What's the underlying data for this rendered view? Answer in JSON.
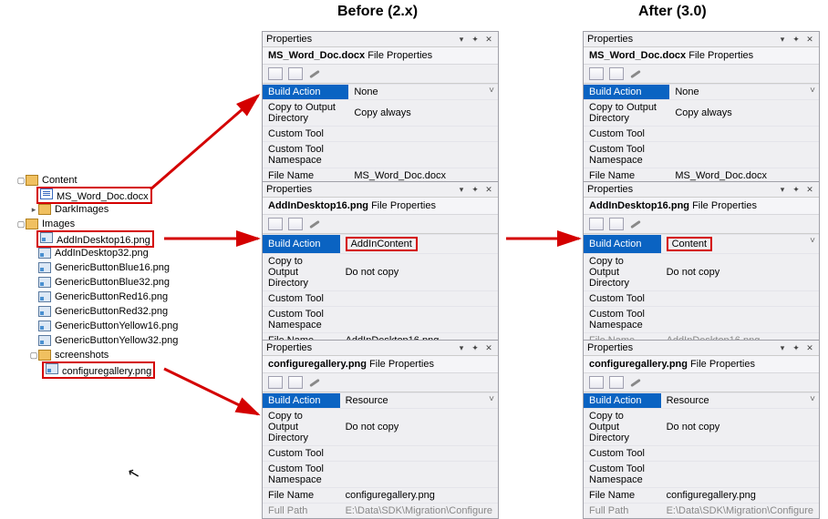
{
  "headers": {
    "before": "Before (2.x)",
    "after": "After (3.0)"
  },
  "tree": {
    "content": "Content",
    "doc": "MS_Word_Doc.docx",
    "dark": "DarkImages",
    "images": "Images",
    "items": [
      "AddInDesktop16.png",
      "AddInDesktop32.png",
      "GenericButtonBlue16.png",
      "GenericButtonBlue32.png",
      "GenericButtonRed16.png",
      "GenericButtonRed32.png",
      "GenericButtonYellow16.png",
      "GenericButtonYellow32.png"
    ],
    "screenshots": "screenshots",
    "cfg": "configuregallery.png"
  },
  "panelTitle": "Properties",
  "subtitleSuffix": "File Properties",
  "fields": {
    "ba": "Build Action",
    "copy": "Copy to Output Directory",
    "ct": "Custom Tool",
    "ctn": "Custom Tool Namespace",
    "fn": "File Name",
    "fp": "Full Path"
  },
  "vals": {
    "none": "None",
    "copyAlways": "Copy always",
    "doNotCopy": "Do not copy",
    "addinContent": "AddInContent",
    "content": "Content",
    "resource": "Resource",
    "doc": "MS_Word_Doc.docx",
    "addin": "AddInDesktop16.png",
    "cfg": "configuregallery.png",
    "path1": "E:\\Data\\SDK\\Migration\\Configu",
    "path2": "E:\\Data\\SDK\\Migration\\Configure"
  }
}
